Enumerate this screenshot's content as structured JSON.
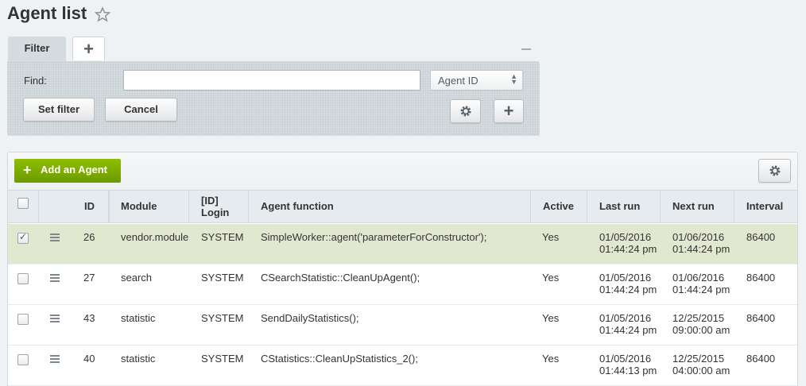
{
  "page": {
    "title": "Agent list"
  },
  "filter": {
    "tab_label": "Filter",
    "find_label": "Find:",
    "find_value": "",
    "field_select": "Agent ID",
    "set_filter_label": "Set filter",
    "cancel_label": "Cancel"
  },
  "toolbar": {
    "add_label": "Add an Agent"
  },
  "columns": [
    "ID",
    "Module",
    "[ID]",
    "Login",
    "Agent function",
    "Active",
    "Last run",
    "Next run",
    "Interval"
  ],
  "rows": [
    {
      "checked": true,
      "id": "26",
      "module": "vendor.module",
      "login": "SYSTEM",
      "function": "SimpleWorker::agent('parameterForConstructor');",
      "active": "Yes",
      "last_run_date": "01/05/2016",
      "last_run_time": "01:44:24 pm",
      "next_run_date": "01/06/2016",
      "next_run_time": "01:44:24 pm",
      "interval": "86400"
    },
    {
      "checked": false,
      "id": "27",
      "module": "search",
      "login": "SYSTEM",
      "function": "CSearchStatistic::CleanUpAgent();",
      "active": "Yes",
      "last_run_date": "01/05/2016",
      "last_run_time": "01:44:24 pm",
      "next_run_date": "01/06/2016",
      "next_run_time": "01:44:24 pm",
      "interval": "86400"
    },
    {
      "checked": false,
      "id": "43",
      "module": "statistic",
      "login": "SYSTEM",
      "function": "SendDailyStatistics();",
      "active": "Yes",
      "last_run_date": "01/05/2016",
      "last_run_time": "01:44:24 pm",
      "next_run_date": "12/25/2015",
      "next_run_time": "09:00:00 am",
      "interval": "86400"
    },
    {
      "checked": false,
      "id": "40",
      "module": "statistic",
      "login": "SYSTEM",
      "function": "CStatistics::CleanUpStatistics_2();",
      "active": "Yes",
      "last_run_date": "01/05/2016",
      "last_run_time": "01:44:13 pm",
      "next_run_date": "12/25/2015",
      "next_run_time": "04:00:00 am",
      "interval": "86400"
    }
  ],
  "colors": {
    "accent_green": "#7aa800",
    "selected_row": "#e2e8d0",
    "header_bg": "#e5ebee"
  }
}
